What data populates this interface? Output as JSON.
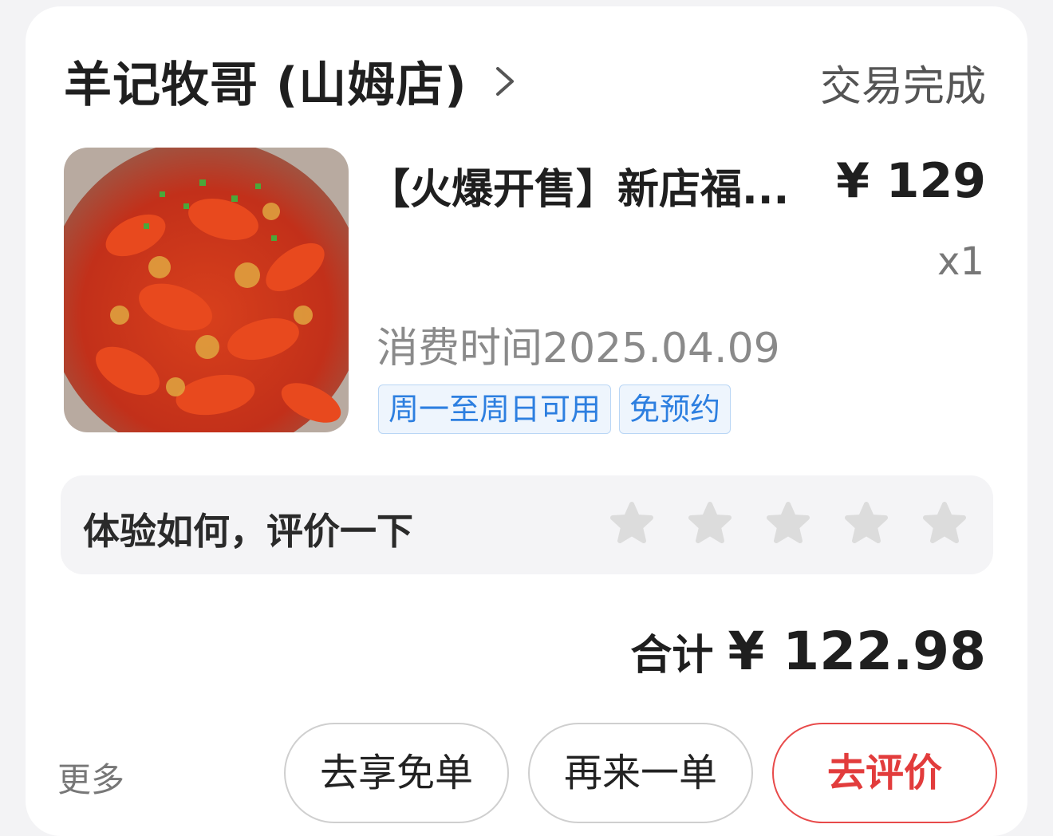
{
  "order": {
    "shop_name": "羊记牧哥 (山姆店)",
    "status": "交易完成",
    "product_title": "【火爆开售】新店福...",
    "price": "¥ 129",
    "quantity": "x1",
    "consume_time": "消费时间2025.04.09",
    "tags": [
      "周一至周日可用",
      "免预约"
    ],
    "image_icon": "crayfish-dish-photo"
  },
  "review": {
    "prompt": "体验如何，评价一下",
    "stars_total": 5,
    "stars_filled": 0
  },
  "total": {
    "label": "合计",
    "amount": "¥ 122.98"
  },
  "actions": {
    "more_label": "更多",
    "free_label": "去享免单",
    "again_label": "再来一单",
    "review_label": "去评价"
  },
  "colors": {
    "accent_red": "#e23c3c",
    "tag_blue": "#2d7fe0",
    "star_gray": "#dcdcdc"
  }
}
